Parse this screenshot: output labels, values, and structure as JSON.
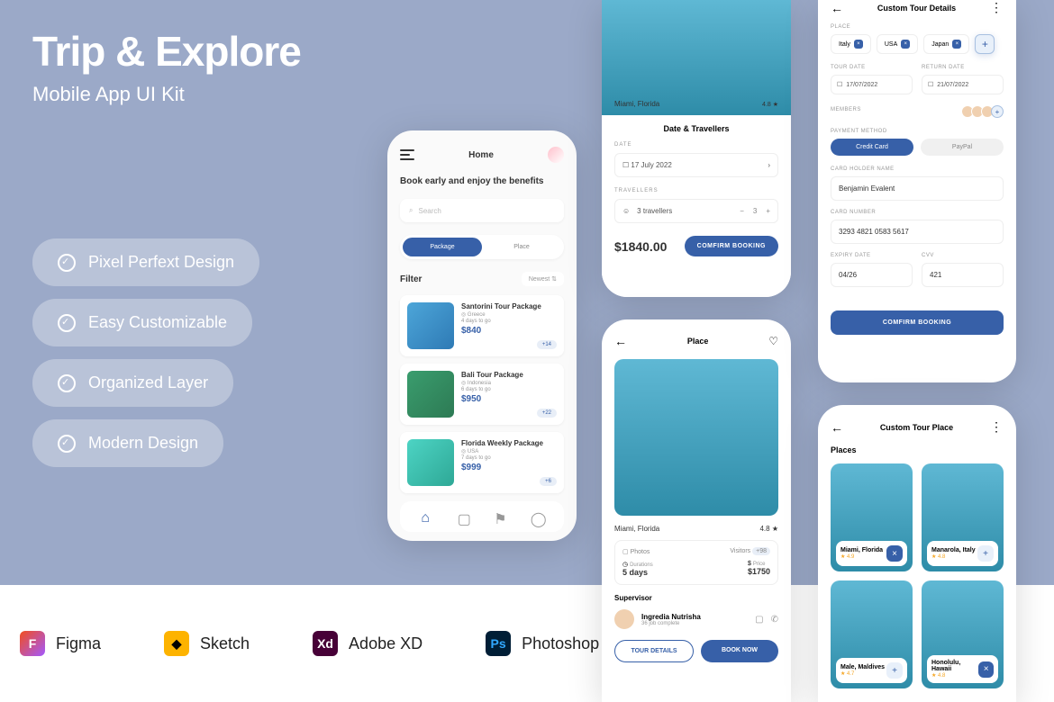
{
  "hero": {
    "title": "Trip & Explore",
    "subtitle": "Mobile App UI Kit"
  },
  "pills": [
    "Pixel Perfext Design",
    "Easy Customizable",
    "Organized Layer",
    "Modern Design"
  ],
  "tools": [
    "Figma",
    "Sketch",
    "Adobe XD",
    "Photoshop"
  ],
  "p1": {
    "title": "Home",
    "tagline": "Book early and enjoy the benefits",
    "search": "Search",
    "tabs": [
      "Package",
      "Place"
    ],
    "filter": "Filter",
    "sort": "Newest",
    "cards": [
      {
        "title": "Santorini Tour Package",
        "loc": "Greece",
        "days": "4 days to go",
        "price": "$840",
        "badge": "+14"
      },
      {
        "title": "Bali Tour Package",
        "loc": "Indonesia",
        "days": "6 days to go",
        "price": "$950",
        "badge": "+22"
      },
      {
        "title": "Florida Weekly Package",
        "loc": "USA",
        "days": "7 days to go",
        "price": "$999",
        "badge": "+6"
      }
    ]
  },
  "p2": {
    "loc": "Miami, Florida",
    "rating": "4.8 ★",
    "sheet_title": "Date & Travellers",
    "date_lbl": "DATE",
    "date": "17 July 2022",
    "trav_lbl": "TRAVELLERS",
    "trav": "3 travellers",
    "count": "3",
    "price": "$1840.00",
    "btn": "COMFIRM BOOKING"
  },
  "p3": {
    "title": "Place",
    "loc": "Miami, Florida",
    "rating": "4.8 ★",
    "photos": "Photos",
    "visitors": "Visitors",
    "vbadge": "+98",
    "dur_k": "Durations",
    "dur_v": "5 days",
    "pr_k": "Price",
    "pr_v": "$1750",
    "sup_lbl": "Supervisor",
    "sup_name": "Ingredia Nutrisha",
    "sup_sub": "36 job complete",
    "btn1": "TOUR DETAILS",
    "btn2": "BOOK NOW"
  },
  "p4": {
    "title": "Custom Tour Details",
    "place_lbl": "PLACE",
    "chips": [
      "Italy",
      "USA",
      "Japan"
    ],
    "tour_lbl": "TOUR DATE",
    "return_lbl": "RETURN DATE",
    "tour_date": "17/07/2022",
    "return_date": "21/07/2022",
    "mem_lbl": "MEMBERS",
    "pay_lbl": "PAYMENT METHOD",
    "pay_tabs": [
      "Credit Card",
      "PayPal"
    ],
    "holder_lbl": "CARD HOLDER NAME",
    "holder": "Benjamin Evalent",
    "card_lbl": "CARD NUMBER",
    "card": "3293 4821 0583 5617",
    "exp_lbl": "EXPIRY DATE",
    "exp": "04/26",
    "cvv_lbl": "CVV",
    "cvv": "421",
    "btn": "COMFIRM BOOKING"
  },
  "p5": {
    "title": "Custom Tour Place",
    "places_lbl": "Places",
    "places": [
      {
        "n": "Miami, Florida",
        "r": "★ 4.9",
        "t": "x"
      },
      {
        "n": "Manarola, Italy",
        "r": "★ 4.8",
        "t": "p"
      },
      {
        "n": "Male, Maldives",
        "r": "★ 4.7",
        "t": "p"
      },
      {
        "n": "Honolulu, Hawaii",
        "r": "★ 4.8",
        "t": "x"
      }
    ]
  }
}
